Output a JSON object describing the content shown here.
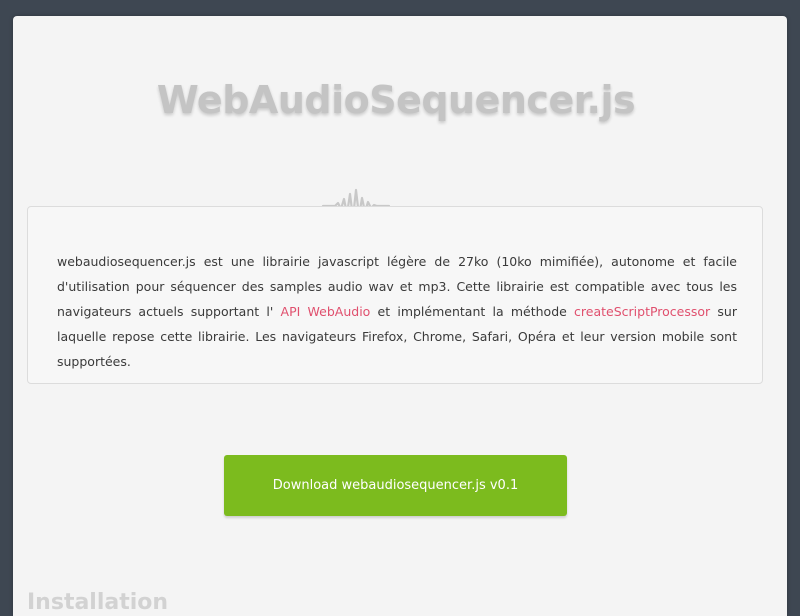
{
  "page": {
    "title": "WebAudioSequencer.js",
    "description": {
      "part1": "webaudiosequencer.js est une librairie javascript légère de 27ko (10ko mimifiée), autonome et facile d'utilisation pour séquencer des samples audio wav et mp3. Cette librairie est compatible avec tous les navigateurs actuels supportant l' ",
      "link1": "API WebAudio",
      "part2": " et implémentant la méthode ",
      "link2": "createScriptProcessor",
      "part3": " sur laquelle repose cette librairie. Les navigateurs Firefox, Chrome, Safari, Opéra et leur version mobile sont supportées."
    },
    "download_label": "Download webaudiosequencer.js v0.1",
    "next_section_heading": "Installation"
  },
  "colors": {
    "background": "#3e4752",
    "card": "#f4f4f4",
    "title": "#c4c4c4",
    "link": "#e0506e",
    "button": "#7cbb1e"
  },
  "icons": {
    "logo_wave": "sound-wave-icon"
  }
}
